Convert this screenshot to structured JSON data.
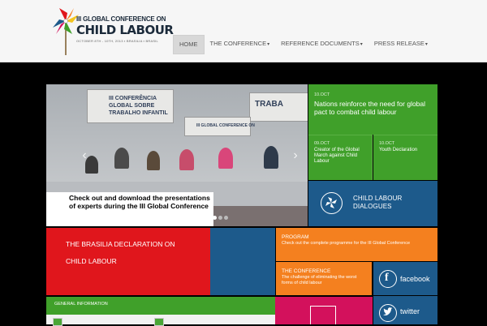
{
  "header": {
    "logo": {
      "line1": "III GLOBAL CONFERENCE ON",
      "line2": "CHILD LABOUR",
      "line3": "OCTOBER 8TH - 10TH, 2013 ▪ BRASILIA ▪ BRASIL"
    },
    "nav": [
      {
        "label": "HOME",
        "has_menu": false,
        "active": true
      },
      {
        "label": "THE CONFERENCE",
        "has_menu": true
      },
      {
        "label": "REFERENCE DOCUMENTS",
        "has_menu": true
      },
      {
        "label": "PRESS RELEASE",
        "has_menu": true
      }
    ]
  },
  "slider": {
    "screen_left": "III CONFERÊNCIA GLOBAL SOBRE TRABALHO INFANTIL",
    "screen_right": "TRABA",
    "screen_center": "III GLOBAL CONFERENCE ON",
    "caption": "Check out and download the presentations of experts during the III Global Conference",
    "prev_glyph": "‹",
    "next_glyph": "›"
  },
  "news": {
    "main": {
      "date": "10.OCT",
      "title": "Nations reinforce the need for global pact to combat child labour"
    },
    "a": {
      "date": "09.OCT",
      "title": "Creator of the Global March against Child Labour"
    },
    "b": {
      "date": "10.OCT",
      "title": "Youth Declaration"
    }
  },
  "dialogues": {
    "line1": "CHILD LABOUR",
    "line2": "DIALOGUES"
  },
  "declaration": {
    "line1": "THE BRASILIA DECLARATION ON",
    "line2": "CHILD LABOUR"
  },
  "program": {
    "title": "PROGRAM",
    "subtitle": "Check out the complete programme for the III Global Conference"
  },
  "conference": {
    "title": "THE CONFERENCE",
    "subtitle": "The challenge of eliminating the worst forms of child labour"
  },
  "social": {
    "facebook": "facebook",
    "twitter": "twitter"
  },
  "general": {
    "title": "GENERAL INFORMATION"
  },
  "colors": {
    "green": "#40a02a",
    "red": "#e0161c",
    "blue": "#1d5a8b",
    "orange": "#f4801f",
    "magenta": "#d3115c"
  }
}
